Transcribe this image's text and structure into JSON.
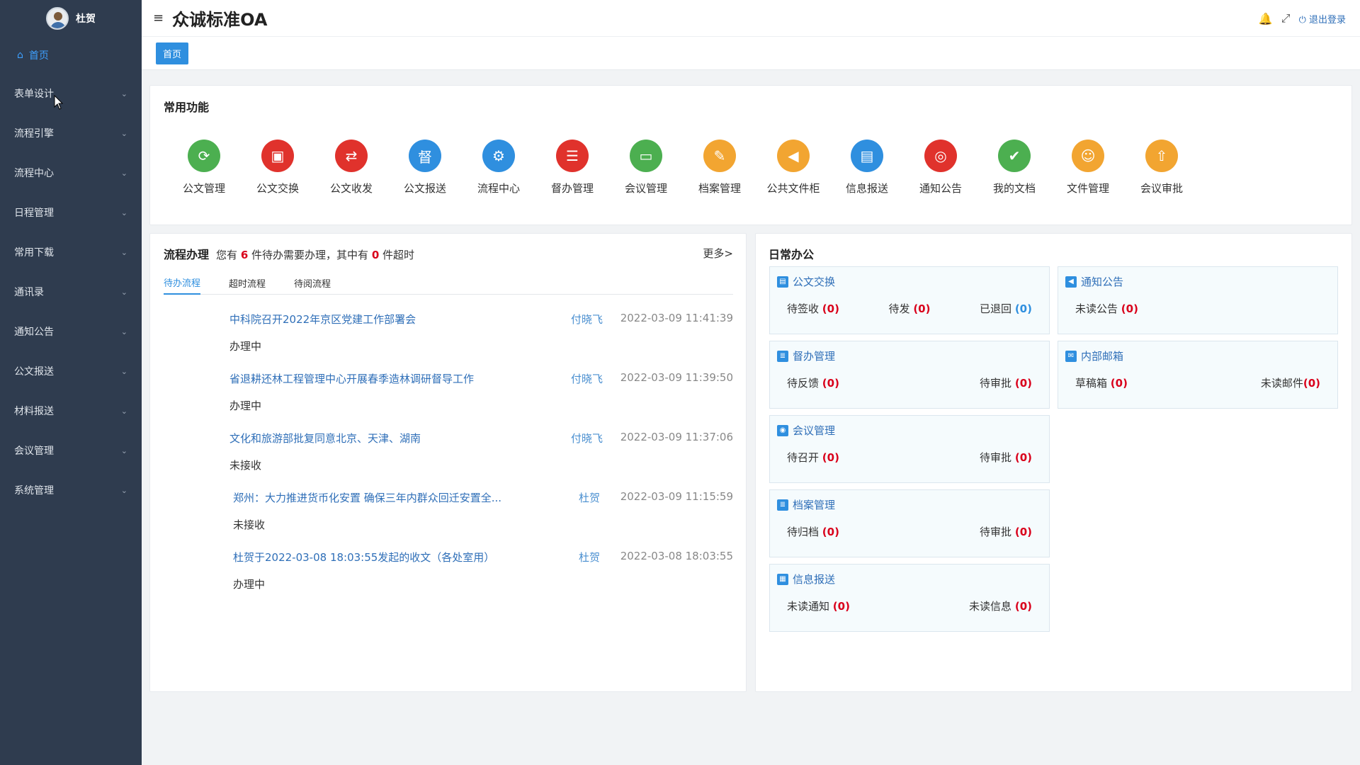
{
  "user": {
    "name": "杜贺"
  },
  "sidebar": {
    "home_label": "首页",
    "items": [
      {
        "label": "表单设计"
      },
      {
        "label": "流程引擎"
      },
      {
        "label": "流程中心"
      },
      {
        "label": "日程管理"
      },
      {
        "label": "常用下载"
      },
      {
        "label": "通讯录"
      },
      {
        "label": "通知公告"
      },
      {
        "label": "公文报送"
      },
      {
        "label": "材料报送"
      },
      {
        "label": "会议管理"
      },
      {
        "label": "系统管理"
      }
    ]
  },
  "topbar": {
    "title": "众诚标准OA",
    "logout": "退出登录"
  },
  "tabs": {
    "home": "首页"
  },
  "common": {
    "title": "常用功能",
    "items": [
      {
        "label": "公文管理",
        "color": "#4caf50",
        "icon": "recycle-icon"
      },
      {
        "label": "公文交换",
        "color": "#e0322c",
        "icon": "document-icon"
      },
      {
        "label": "公文收发",
        "color": "#e0322c",
        "icon": "send-receive-icon"
      },
      {
        "label": "公文报送",
        "color": "#2f8fdf",
        "icon": "supervise-icon"
      },
      {
        "label": "流程中心",
        "color": "#2f8fdf",
        "icon": "flow-icon"
      },
      {
        "label": "督办管理",
        "color": "#e0322c",
        "icon": "clipboard-icon"
      },
      {
        "label": "会议管理",
        "color": "#4caf50",
        "icon": "folder-icon"
      },
      {
        "label": "档案管理",
        "color": "#f2a531",
        "icon": "archive-icon"
      },
      {
        "label": "公共文件柜",
        "color": "#f2a531",
        "icon": "speaker-icon"
      },
      {
        "label": "信息报送",
        "color": "#2f8fdf",
        "icon": "file-icon"
      },
      {
        "label": "通知公告",
        "color": "#e0322c",
        "icon": "notice-icon"
      },
      {
        "label": "我的文档",
        "color": "#4caf50",
        "icon": "my-doc-icon"
      },
      {
        "label": "文件管理",
        "color": "#f2a531",
        "icon": "file-manage-icon"
      },
      {
        "label": "会议审批",
        "color": "#f2a531",
        "icon": "upload-icon"
      }
    ]
  },
  "flow": {
    "title": "流程办理",
    "summary_prefix": "您有",
    "pending_count": "6",
    "summary_middle": "件待办需要办理，其中有",
    "overtime_count": "0",
    "summary_suffix": "件超时",
    "more": "更多>",
    "tabs": [
      "待办流程",
      "超时流程",
      "待阅流程"
    ],
    "rows": [
      {
        "title": "中科院召开2022年京区党建工作部署会",
        "user": "付晓飞",
        "time": "2022-03-09 11:41:39",
        "status": "办理中"
      },
      {
        "title": "省退耕还林工程管理中心开展春季造林调研督导工作",
        "user": "付晓飞",
        "time": "2022-03-09 11:39:50",
        "status": "办理中"
      },
      {
        "title": "文化和旅游部批复同意北京、天津、湖南",
        "user": "付晓飞",
        "time": "2022-03-09 11:37:06",
        "status": "未接收"
      },
      {
        "title": "郑州：大力推进货币化安置 确保三年内群众回迁安置全...",
        "user": "杜贺",
        "time": "2022-03-09 11:15:59",
        "status": "未接收"
      },
      {
        "title": "杜贺于2022-03-08 18:03:55发起的收文（各处室用）",
        "user": "杜贺",
        "time": "2022-03-08 18:03:55",
        "status": "办理中"
      }
    ]
  },
  "daily": {
    "title": "日常办公",
    "boxes": [
      {
        "title": "公文交换",
        "items": [
          {
            "label": "待签收",
            "count": "(0)"
          },
          {
            "label": "待发",
            "count": "(0)"
          },
          {
            "label": "已退回",
            "count": "(0)"
          }
        ]
      },
      {
        "title": "通知公告",
        "items": [
          {
            "label": "未读公告",
            "count": "(0)"
          }
        ]
      },
      {
        "title": "督办管理",
        "items": [
          {
            "label": "待反馈",
            "count": "(0)"
          },
          {
            "label": "待审批",
            "count": "(0)"
          }
        ]
      },
      {
        "title": "内部邮箱",
        "items": [
          {
            "label": "草稿箱",
            "count": "(0)"
          },
          {
            "label": "未读邮件",
            "count": "(0)"
          }
        ]
      },
      {
        "title": "会议管理",
        "items": [
          {
            "label": "待召开",
            "count": "(0)"
          },
          {
            "label": "待审批",
            "count": "(0)"
          }
        ]
      },
      {
        "title": "档案管理",
        "items": [
          {
            "label": "待归档",
            "count": "(0)"
          },
          {
            "label": "待审批",
            "count": "(0)"
          }
        ]
      },
      {
        "title": "信息报送",
        "items": [
          {
            "label": "未读通知",
            "count": "(0)"
          },
          {
            "label": "未读信息",
            "count": "(0)"
          }
        ]
      }
    ]
  }
}
